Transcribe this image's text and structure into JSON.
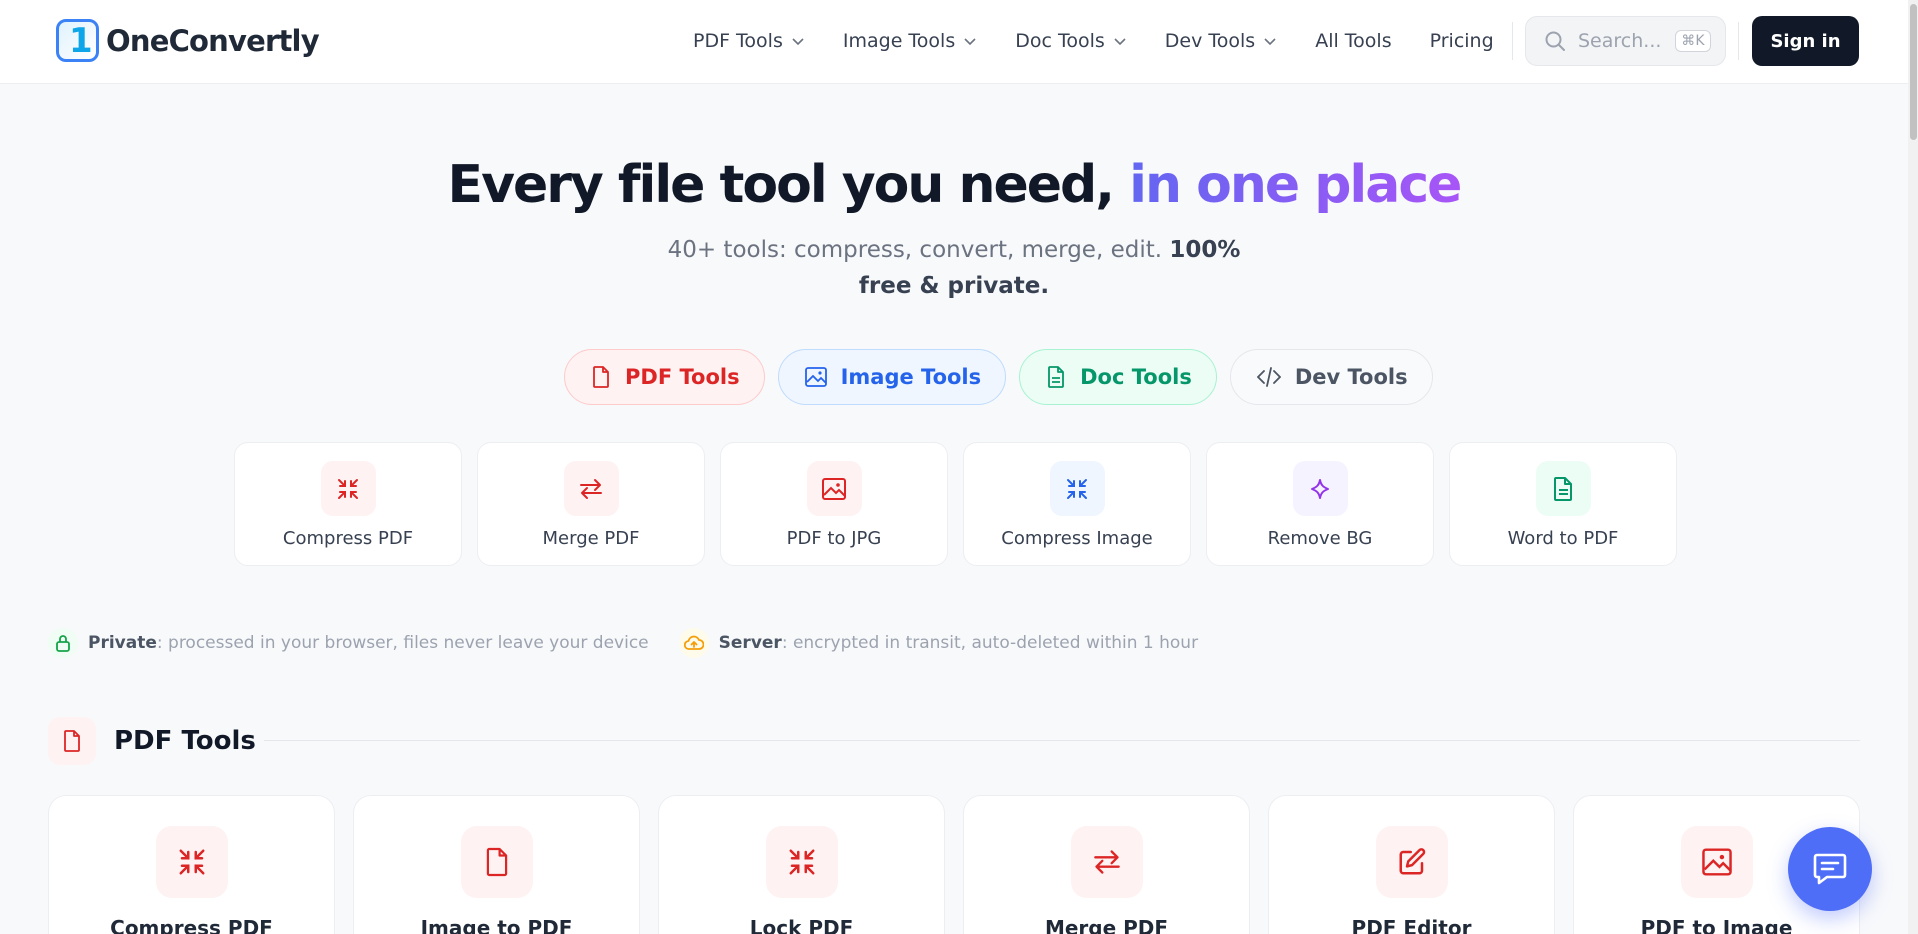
{
  "brand": {
    "name": "OneConvertly"
  },
  "nav": {
    "items": [
      {
        "label": "PDF Tools",
        "dropdown": true
      },
      {
        "label": "Image Tools",
        "dropdown": true
      },
      {
        "label": "Doc Tools",
        "dropdown": true
      },
      {
        "label": "Dev Tools",
        "dropdown": true
      },
      {
        "label": "All Tools",
        "dropdown": false
      },
      {
        "label": "Pricing",
        "dropdown": false
      }
    ],
    "search_placeholder": "Search...",
    "search_shortcut": "⌘K",
    "signin_label": "Sign in"
  },
  "hero": {
    "title_main": "Every file tool you need, ",
    "title_accent": "in one place",
    "subtitle_plain": "40+ tools: compress, convert, merge, edit. ",
    "subtitle_bold": "100% free & private."
  },
  "categories": [
    {
      "label": "PDF Tools",
      "icon": "file-icon"
    },
    {
      "label": "Image Tools",
      "icon": "image-icon"
    },
    {
      "label": "Doc Tools",
      "icon": "document-icon"
    },
    {
      "label": "Dev Tools",
      "icon": "code-icon"
    }
  ],
  "quick_tools": [
    {
      "label": "Compress PDF",
      "icon": "compress-icon",
      "color": "#dc2626",
      "bg": "#fef2f2"
    },
    {
      "label": "Merge PDF",
      "icon": "swap-arrows-icon",
      "color": "#dc2626",
      "bg": "#fef2f2"
    },
    {
      "label": "PDF to JPG",
      "icon": "image-icon",
      "color": "#dc2626",
      "bg": "#fef2f2"
    },
    {
      "label": "Compress Image",
      "icon": "compress-icon",
      "color": "#2563eb",
      "bg": "#eff6ff"
    },
    {
      "label": "Remove BG",
      "icon": "sparkle-icon",
      "color": "#9333ea",
      "bg": "#f5f3ff"
    },
    {
      "label": "Word to PDF",
      "icon": "document-icon",
      "color": "#059669",
      "bg": "#ecfdf5"
    }
  ],
  "notes": [
    {
      "title": "Private",
      "text": ": processed in your browser, files never leave your device",
      "icon": "lock-icon",
      "color": "#16a34a",
      "bg": "#f0fdf4"
    },
    {
      "title": "Server",
      "text": ": encrypted in transit, auto-deleted within 1 hour",
      "icon": "cloud-upload-icon",
      "color": "#f59e0b",
      "bg": "#fffbeb"
    }
  ],
  "section": {
    "title": "PDF Tools",
    "icon": "file-icon",
    "tools": [
      {
        "label": "Compress PDF",
        "icon": "compress-icon"
      },
      {
        "label": "Image to PDF",
        "icon": "file-icon"
      },
      {
        "label": "Lock PDF",
        "icon": "compress-icon"
      },
      {
        "label": "Merge PDF",
        "icon": "swap-arrows-icon"
      },
      {
        "label": "PDF Editor",
        "icon": "pencil-icon"
      },
      {
        "label": "PDF to Image",
        "icon": "image-icon"
      }
    ]
  },
  "colors": {
    "accent_start": "#6366f1",
    "accent_end": "#a855f7",
    "pdf_red": "#dc2626",
    "chat": "#4f6ef7"
  }
}
